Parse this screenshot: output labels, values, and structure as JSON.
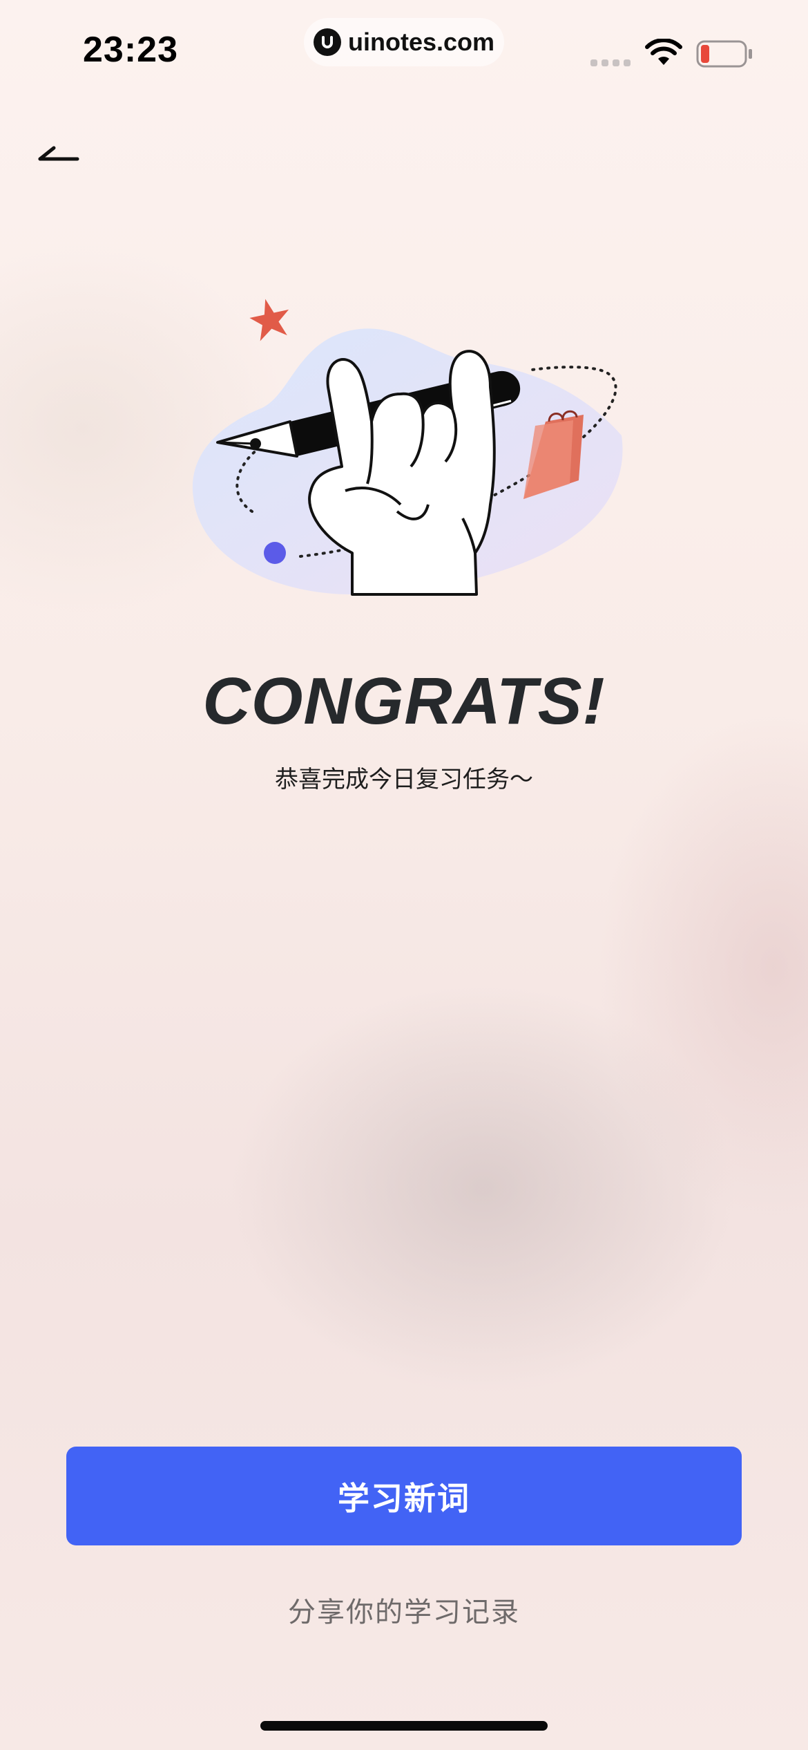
{
  "status_bar": {
    "time": "23:23",
    "url": "uinotes.com",
    "battery_color": "#e8483a"
  },
  "nav": {
    "back_icon": "arrow-left-icon"
  },
  "main": {
    "title": "CONGRATS!",
    "subtitle": "恭喜完成今日复习任务～",
    "illustration": "hand-holding-pen-illustration"
  },
  "actions": {
    "primary_label": "学习新词",
    "secondary_label": "分享你的学习记录"
  },
  "colors": {
    "accent": "#4263f5",
    "title": "#26292c"
  }
}
